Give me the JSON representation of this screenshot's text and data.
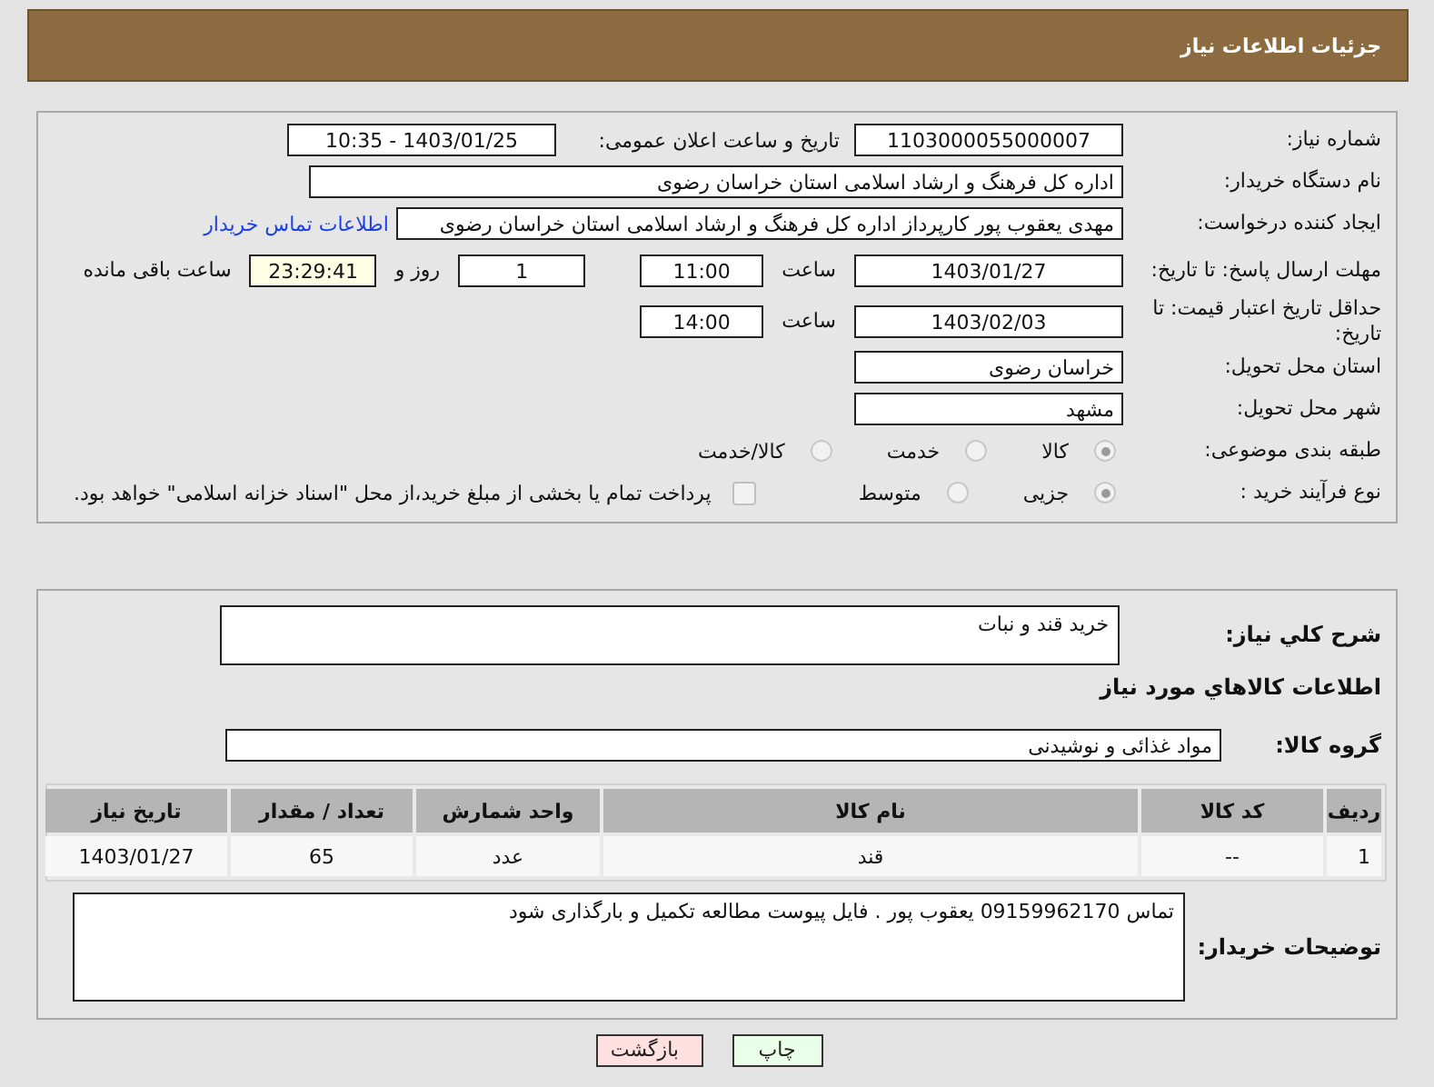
{
  "header": {
    "title": "جزئیات اطلاعات نیاز"
  },
  "details": {
    "need_number": {
      "label": "شماره نیاز:",
      "value": "1103000055000007"
    },
    "announce": {
      "label": "تاریخ و ساعت اعلان عمومی:",
      "value": "1403/01/25 - 10:35"
    },
    "buyer_org": {
      "label": "نام دستگاه خریدار:",
      "value": "اداره کل فرهنگ و ارشاد اسلامی استان خراسان رضوی"
    },
    "creator": {
      "label": "ایجاد کننده درخواست:",
      "value": "مهدی یعقوب پور کارپرداز اداره کل فرهنگ و ارشاد اسلامی استان خراسان رضوی",
      "link": "اطلاعات تماس خریدار"
    },
    "reply_deadline": {
      "label": "مهلت ارسال پاسخ: تا تاریخ:",
      "date": "1403/01/27",
      "time_label": "ساعت",
      "time": "11:00",
      "days": "1",
      "days_label": "روز و",
      "remaining": "23:29:41",
      "remaining_label": "ساعت باقی مانده"
    },
    "price_validity": {
      "label": "حداقل تاریخ اعتبار قیمت: تا تاریخ:",
      "date": "1403/02/03",
      "time_label": "ساعت",
      "time": "14:00"
    },
    "province": {
      "label": "استان محل تحویل:",
      "value": "خراسان رضوی"
    },
    "city": {
      "label": "شهر محل تحویل:",
      "value": "مشهد"
    },
    "category": {
      "label": "طبقه بندی موضوعی:",
      "options": [
        {
          "label": "کالا",
          "selected": true
        },
        {
          "label": "خدمت",
          "selected": false
        },
        {
          "label": "کالا/خدمت",
          "selected": false
        }
      ]
    },
    "process": {
      "label": "نوع فرآیند خرید :",
      "options": [
        {
          "label": "جزیی",
          "selected": true
        },
        {
          "label": "متوسط",
          "selected": false
        }
      ],
      "payment": {
        "label": "پرداخت تمام یا بخشی از مبلغ خرید،از محل \"اسناد خزانه اسلامی\" خواهد بود.",
        "checked": false
      }
    }
  },
  "needs": {
    "description": {
      "label": "شرح کلي نياز:",
      "value": "خرید قند و نبات"
    },
    "goods_heading": "اطلاعات کالاهاي مورد نياز",
    "goods_group": {
      "label": "گروه کالا:",
      "value": "مواد غذائی و نوشیدنی"
    },
    "table": {
      "columns": [
        "ردیف",
        "کد کالا",
        "نام کالا",
        "واحد شمارش",
        "تعداد / مقدار",
        "تاریخ نیاز"
      ],
      "rows": [
        [
          "1",
          "--",
          "قند",
          "عدد",
          "65",
          "1403/01/27"
        ]
      ]
    },
    "buyer_notes": {
      "label": "توضیحات خریدار:",
      "value": "تماس 09159962170 یعقوب پور . فایل پیوست مطالعه تکمیل و بارگذاری شود"
    }
  },
  "buttons": [
    {
      "label": "چاپ",
      "kind": "print"
    },
    {
      "label": "بازگشت",
      "kind": "back"
    }
  ]
}
